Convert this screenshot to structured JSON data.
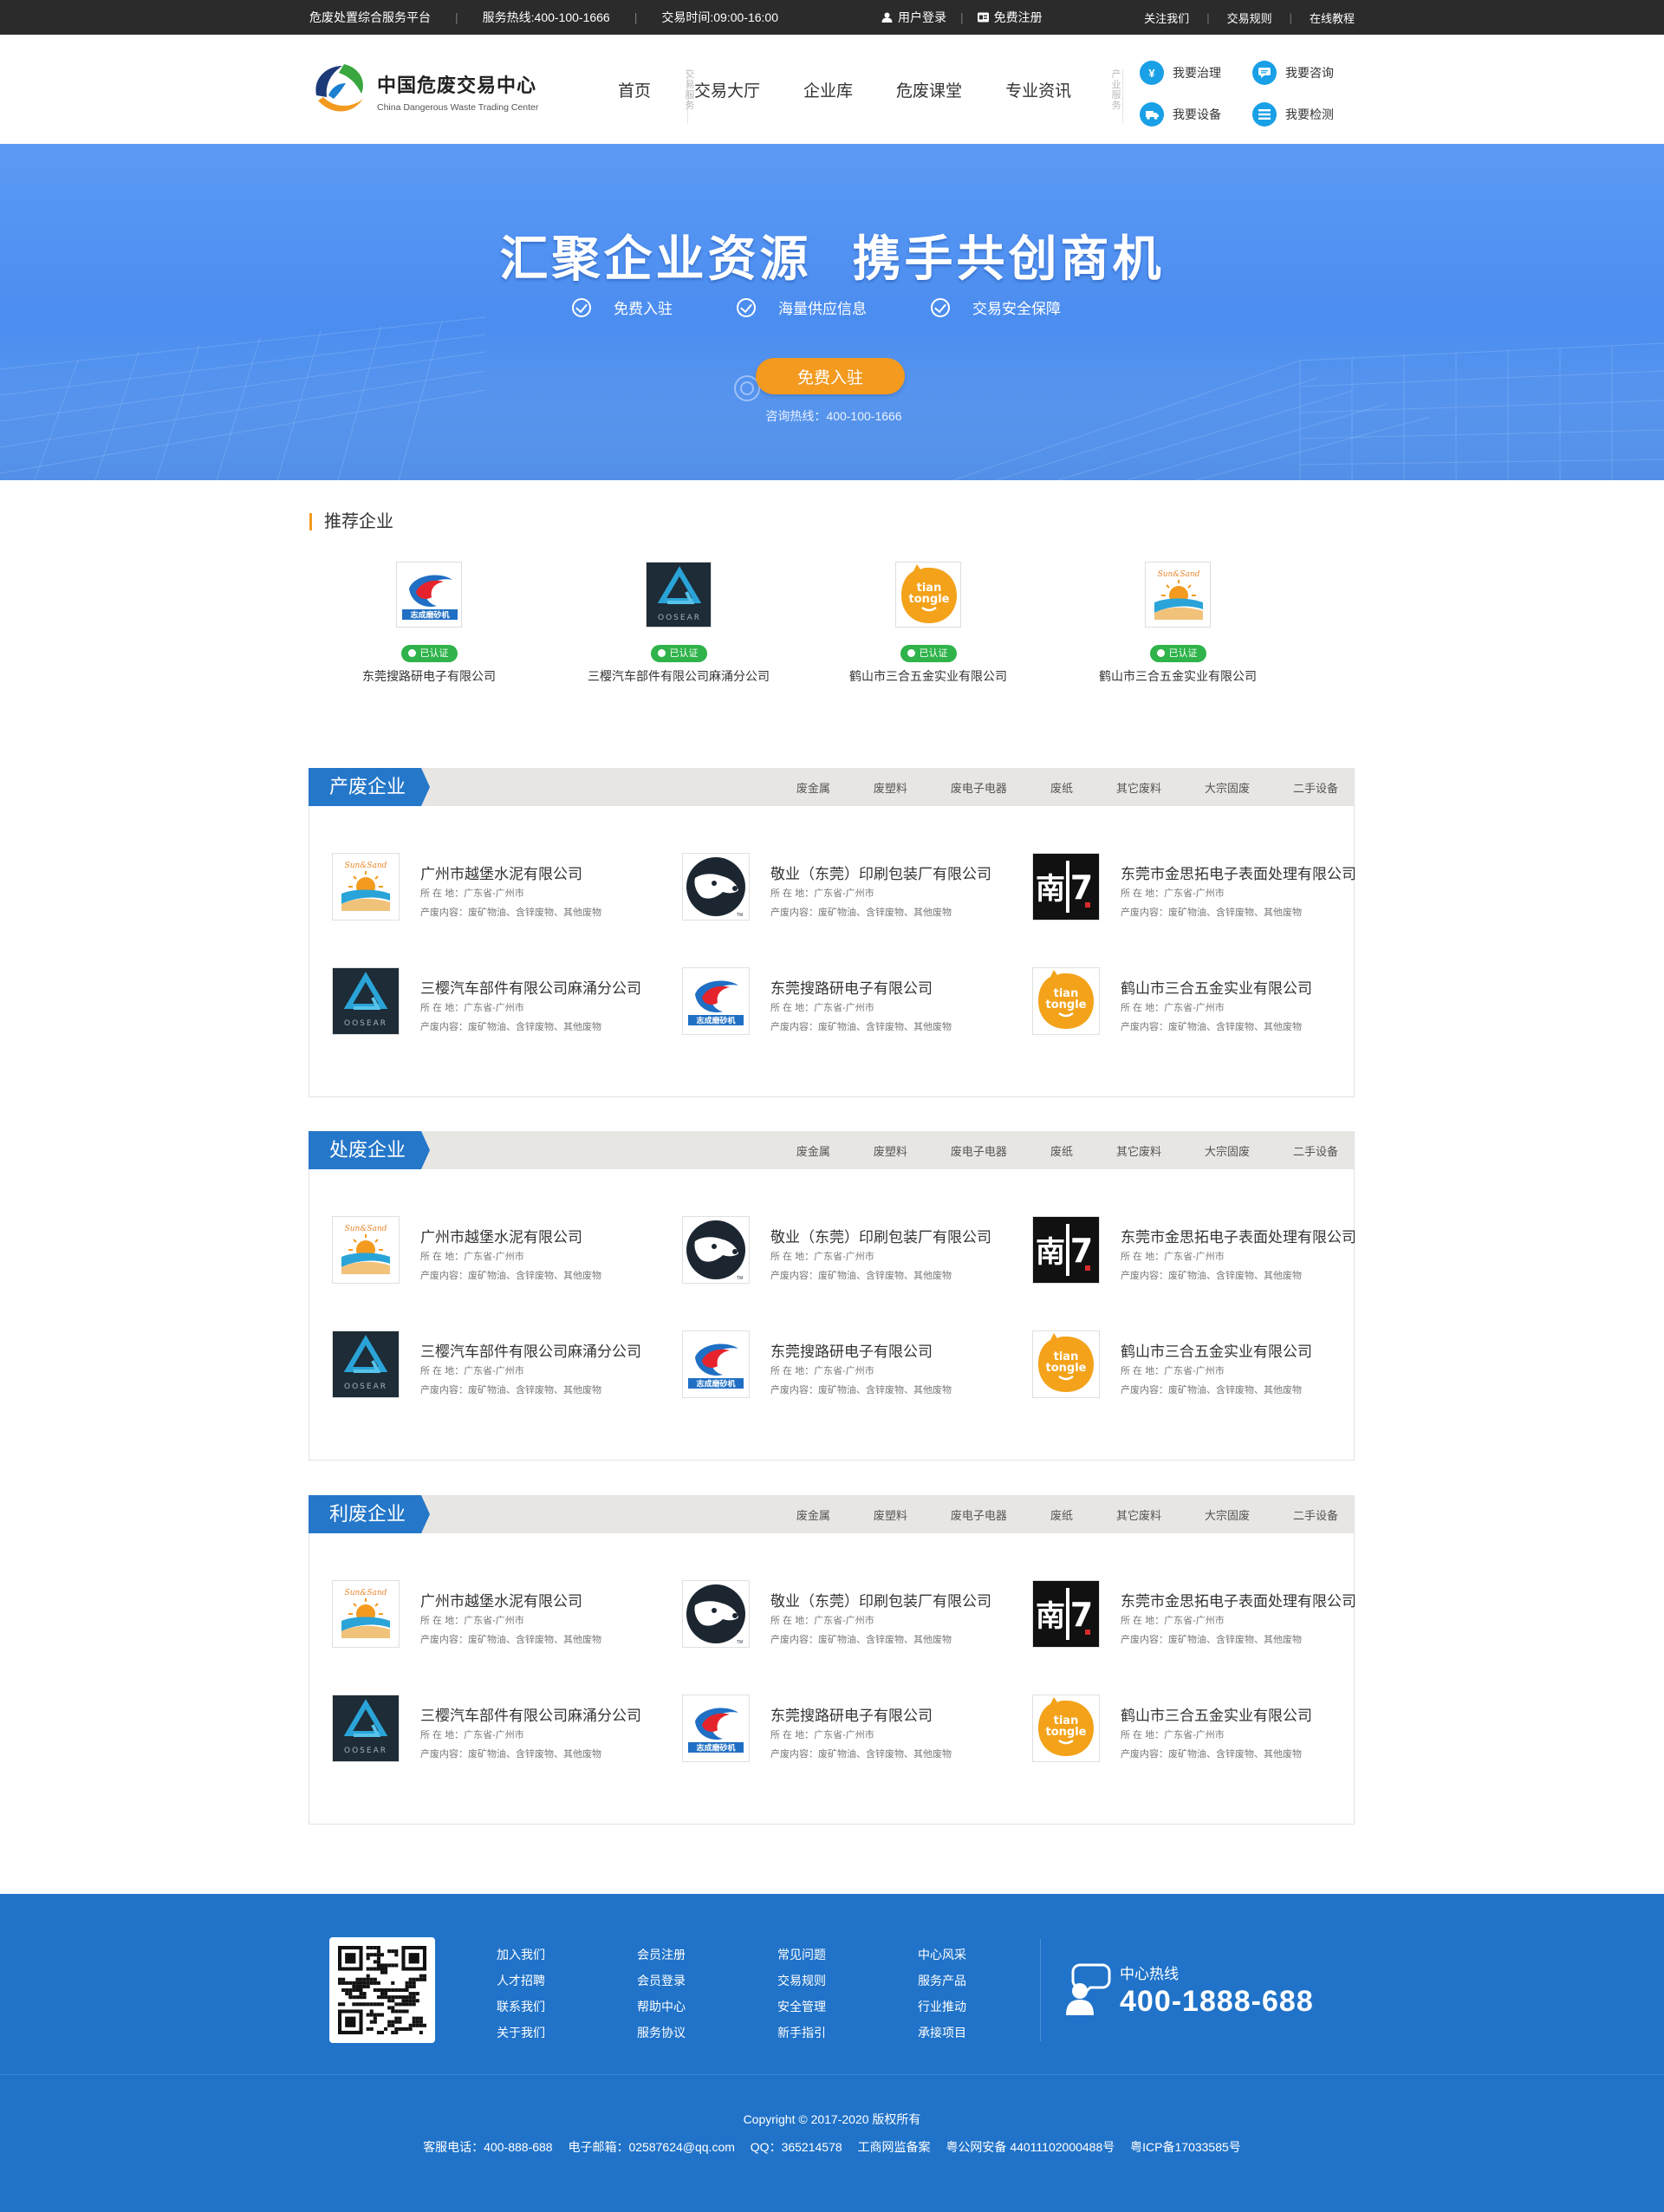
{
  "topbar": {
    "platform": "危废处置综合服务平台",
    "hotline": "服务热线:400-100-1666",
    "hours": "交易时间:09:00-16:00",
    "login": "用户登录",
    "register": "免费注册",
    "links": [
      "关注我们",
      "交易规则",
      "在线教程"
    ]
  },
  "logo": {
    "cn": "中国危废交易中心",
    "en": "China Dangerous Waste Trading Center"
  },
  "nav": {
    "items": [
      "首页",
      "交易大厅",
      "企业库",
      "危废课堂",
      "专业资讯"
    ],
    "label_trade": "交易服务",
    "label_industry": "产业服务"
  },
  "services": [
    {
      "label": "我要治理",
      "icon": "yen-icon"
    },
    {
      "label": "我要咨询",
      "icon": "chat-icon"
    },
    {
      "label": "我要设备",
      "icon": "truck-icon"
    },
    {
      "label": "我要检测",
      "icon": "list-icon"
    }
  ],
  "banner": {
    "title": "汇聚企业资源  携手共创商机",
    "features": [
      "免费入驻",
      "海量供应信息",
      "交易安全保障"
    ],
    "cta": "免费入驻",
    "hotline": "咨询热线：400-100-1666"
  },
  "recommended": {
    "title": "推荐企业",
    "items": [
      {
        "name": "东莞搜路研电子有限公司",
        "badge": "已认证",
        "logo": "zhicheng"
      },
      {
        "name": "三樱汽车部件有限公司麻涌分公司",
        "badge": "已认证",
        "logo": "oosear"
      },
      {
        "name": "鹤山市三合五金实业有限公司",
        "badge": "已认证",
        "logo": "tiantongle"
      },
      {
        "name": "鹤山市三合五金实业有限公司",
        "badge": "已认证",
        "logo": "sunsand"
      }
    ]
  },
  "sections": [
    {
      "title": "产废企业"
    },
    {
      "title": "处废企业"
    },
    {
      "title": "利废企业"
    }
  ],
  "categories": [
    "废金属",
    "废塑料",
    "废电子电器",
    "废纸",
    "其它废料",
    "大宗固废",
    "二手设备"
  ],
  "companies": [
    {
      "name": "广州市越堡水泥有限公司",
      "address": "所 在 地：广东省-广州市",
      "content": "产废内容：废矿物油、含锌废物、其他废物",
      "logo": "sunsand"
    },
    {
      "name": "敬业（东莞）印刷包装厂有限公司",
      "address": "所 在 地：广东省-广州市",
      "content": "产废内容：废矿物油、含锌废物、其他废物",
      "logo": "dog"
    },
    {
      "name": "东莞市金思拓电子表面处理有限公司",
      "address": "所 在 地：广东省-广州市",
      "content": "产废内容：废矿物油、含锌废物、其他废物",
      "logo": "nan7"
    },
    {
      "name": "三樱汽车部件有限公司麻涌分公司",
      "address": "所 在 地：广东省-广州市",
      "content": "产废内容：废矿物油、含锌废物、其他废物",
      "logo": "oosear"
    },
    {
      "name": "东莞搜路研电子有限公司",
      "address": "所 在 地：广东省-广州市",
      "content": "产废内容：废矿物油、含锌废物、其他废物",
      "logo": "zhicheng"
    },
    {
      "name": "鹤山市三合五金实业有限公司",
      "address": "所 在 地：广东省-广州市",
      "content": "产废内容：废矿物油、含锌废物、其他废物",
      "logo": "tiantongle"
    }
  ],
  "footer": {
    "columns": [
      [
        "加入我们",
        "人才招聘",
        "联系我们",
        "关于我们"
      ],
      [
        "会员注册",
        "会员登录",
        "帮助中心",
        "服务协议"
      ],
      [
        "常见问题",
        "交易规则",
        "安全管理",
        "新手指引"
      ],
      [
        "中心风采",
        "服务产品",
        "行业推动",
        "承接项目"
      ]
    ],
    "hotline_label": "中心热线",
    "hotline": "400-1888-688",
    "copyright": "Copyright © 2017-2020  版权所有",
    "info": [
      "客服电话：400-888-688",
      "电子邮箱：02587624@qq.com",
      "QQ：365214578",
      "工商网监备案",
      "粤公网安备 44011102000488号",
      "粤ICP备17033585号"
    ]
  },
  "colors": {
    "brand_blue": "#2073c9",
    "accent_orange": "#f39a1f",
    "verified_green": "#2fb34a",
    "topbar": "#2b2b2b"
  }
}
